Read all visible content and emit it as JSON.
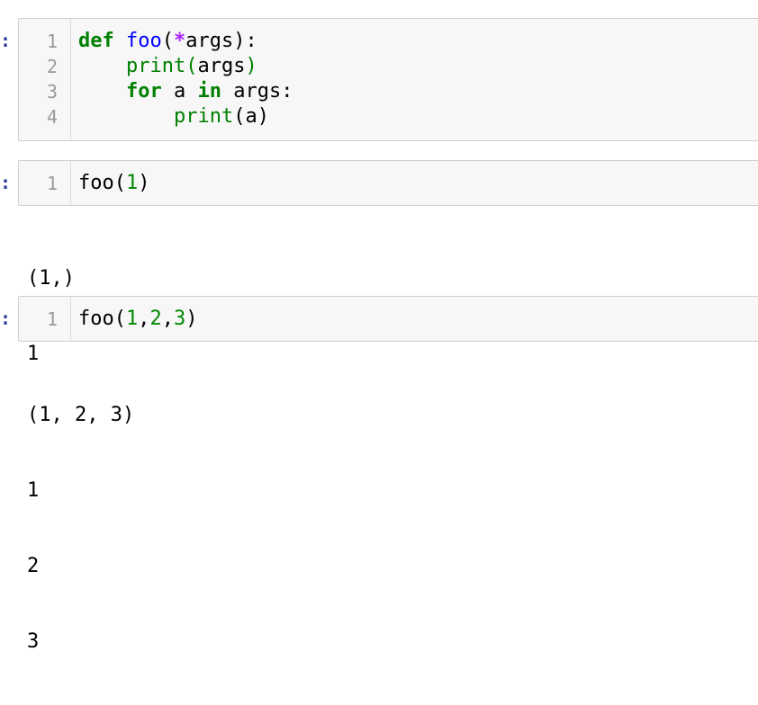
{
  "prompt_marker": ":",
  "cells": [
    {
      "line_numbers": [
        "1",
        "2",
        "3",
        "4"
      ],
      "code": {
        "l1": {
          "kw_def": "def",
          "fn_name": "foo",
          "paren_open": "(",
          "star": "*",
          "args": "args):"
        },
        "l2": {
          "indent": "    ",
          "print": "print",
          "paren": "(",
          "arg": "args",
          "close": ")"
        },
        "l3": {
          "indent": "    ",
          "kw_for": "for",
          "mid": " a ",
          "kw_in": "in",
          "rest": " args:"
        },
        "l4": {
          "indent": "        ",
          "print": "print",
          "rest": "(a)"
        }
      }
    },
    {
      "line_numbers": [
        "1"
      ],
      "code": {
        "fn": "foo",
        "open": "(",
        "arg": "1",
        "close": ")"
      },
      "output": [
        "(1,)",
        "1"
      ]
    },
    {
      "line_numbers": [
        "1"
      ],
      "code": {
        "fn": "foo",
        "open": "(",
        "n1": "1",
        "c1": ",",
        "n2": "2",
        "c2": ",",
        "n3": "3",
        "close": ")"
      },
      "output": [
        "(1, 2, 3)",
        "1",
        "2",
        "3"
      ]
    }
  ]
}
